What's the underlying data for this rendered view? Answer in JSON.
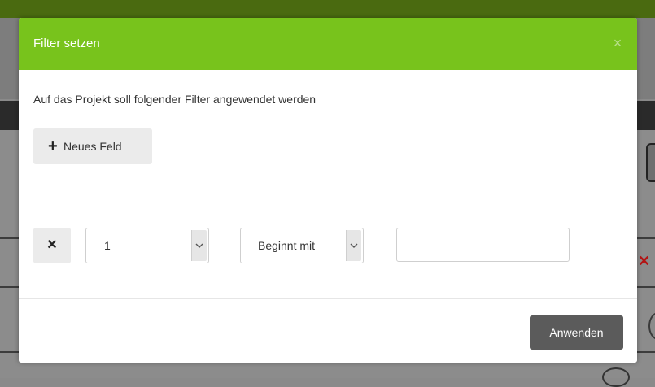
{
  "modal": {
    "title": "Filter setzen",
    "close_icon": "close-icon",
    "close_glyph": "×",
    "description": "Auf das Projekt soll folgender Filter angewendet werden",
    "add_field_button": {
      "icon": "plus-icon",
      "glyph": "+",
      "label": "Neues Feld"
    },
    "filter_row": {
      "remove_button": {
        "icon": "close-icon",
        "glyph": "✕"
      },
      "field_select": {
        "value": "1",
        "icon": "chevron-down-icon"
      },
      "operator_select": {
        "value": "Beginnt mit",
        "icon": "chevron-down-icon"
      },
      "value_input": {
        "value": "",
        "placeholder": ""
      }
    },
    "apply_button": {
      "label": "Anwenden"
    }
  },
  "colors": {
    "header": "#78c31c",
    "apply_button": "#5b5b5b",
    "secondary_button": "#ebebeb"
  }
}
